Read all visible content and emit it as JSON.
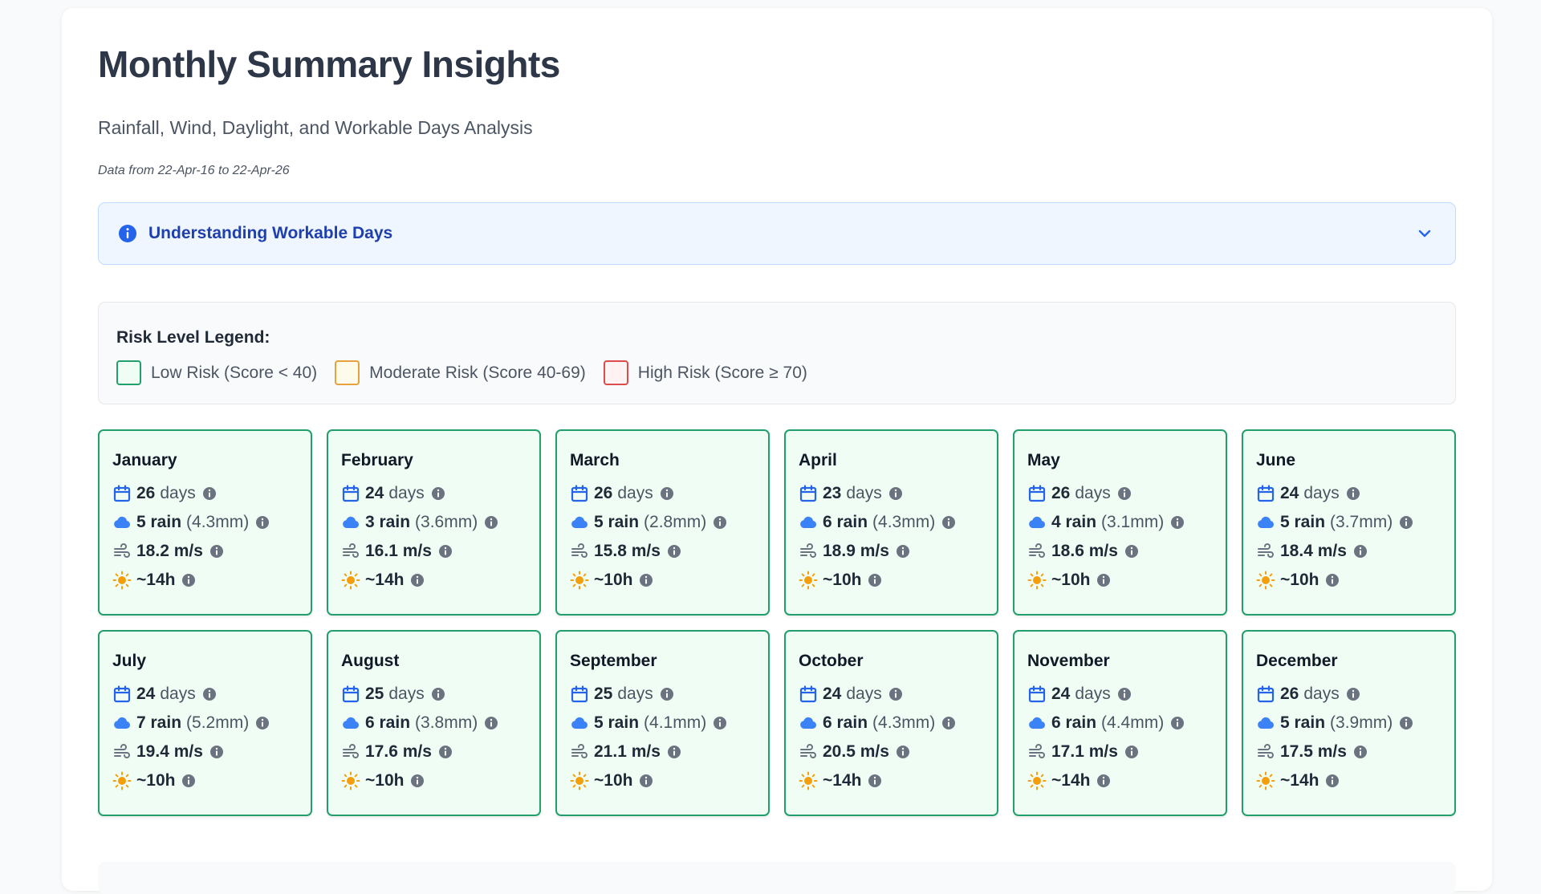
{
  "header": {
    "title": "Monthly Summary Insights",
    "subtitle": "Rainfall, Wind, Daylight, and Workable Days Analysis",
    "date_range": "Data from 22-Apr-16 to 22-Apr-26"
  },
  "info_panel": {
    "label": "Understanding Workable Days",
    "expanded": false
  },
  "legend": {
    "heading": "Risk Level Legend:",
    "items": [
      {
        "label": "Low Risk (Score < 40)",
        "color": "#22a06b"
      },
      {
        "label": "Moderate Risk (Score 40-69)",
        "color": "#e6a23c"
      },
      {
        "label": "High Risk (Score ≥ 70)",
        "color": "#dc4c4c"
      }
    ]
  },
  "colors": {
    "low_border": "#22a06b",
    "low_bg": "#f0fdf4",
    "info_blue": "#2563eb",
    "cloud": "#3b82f6",
    "sun": "#f59e0b"
  },
  "months": [
    {
      "name": "January",
      "days": "26",
      "days_unit": "days",
      "rain": "5 rain",
      "rain_mm": "(4.3mm)",
      "wind": "18.2 m/s",
      "daylight": "~14h",
      "risk": "low"
    },
    {
      "name": "February",
      "days": "24",
      "days_unit": "days",
      "rain": "3 rain",
      "rain_mm": "(3.6mm)",
      "wind": "16.1 m/s",
      "daylight": "~14h",
      "risk": "low"
    },
    {
      "name": "March",
      "days": "26",
      "days_unit": "days",
      "rain": "5 rain",
      "rain_mm": "(2.8mm)",
      "wind": "15.8 m/s",
      "daylight": "~10h",
      "risk": "low"
    },
    {
      "name": "April",
      "days": "23",
      "days_unit": "days",
      "rain": "6 rain",
      "rain_mm": "(4.3mm)",
      "wind": "18.9 m/s",
      "daylight": "~10h",
      "risk": "low"
    },
    {
      "name": "May",
      "days": "26",
      "days_unit": "days",
      "rain": "4 rain",
      "rain_mm": "(3.1mm)",
      "wind": "18.6 m/s",
      "daylight": "~10h",
      "risk": "low"
    },
    {
      "name": "June",
      "days": "24",
      "days_unit": "days",
      "rain": "5 rain",
      "rain_mm": "(3.7mm)",
      "wind": "18.4 m/s",
      "daylight": "~10h",
      "risk": "low"
    },
    {
      "name": "July",
      "days": "24",
      "days_unit": "days",
      "rain": "7 rain",
      "rain_mm": "(5.2mm)",
      "wind": "19.4 m/s",
      "daylight": "~10h",
      "risk": "low"
    },
    {
      "name": "August",
      "days": "25",
      "days_unit": "days",
      "rain": "6 rain",
      "rain_mm": "(3.8mm)",
      "wind": "17.6 m/s",
      "daylight": "~10h",
      "risk": "low"
    },
    {
      "name": "September",
      "days": "25",
      "days_unit": "days",
      "rain": "5 rain",
      "rain_mm": "(4.1mm)",
      "wind": "21.1 m/s",
      "daylight": "~10h",
      "risk": "low"
    },
    {
      "name": "October",
      "days": "24",
      "days_unit": "days",
      "rain": "6 rain",
      "rain_mm": "(4.3mm)",
      "wind": "20.5 m/s",
      "daylight": "~14h",
      "risk": "low"
    },
    {
      "name": "November",
      "days": "24",
      "days_unit": "days",
      "rain": "6 rain",
      "rain_mm": "(4.4mm)",
      "wind": "17.1 m/s",
      "daylight": "~14h",
      "risk": "low"
    },
    {
      "name": "December",
      "days": "26",
      "days_unit": "days",
      "rain": "5 rain",
      "rain_mm": "(3.9mm)",
      "wind": "17.5 m/s",
      "daylight": "~14h",
      "risk": "low"
    }
  ]
}
